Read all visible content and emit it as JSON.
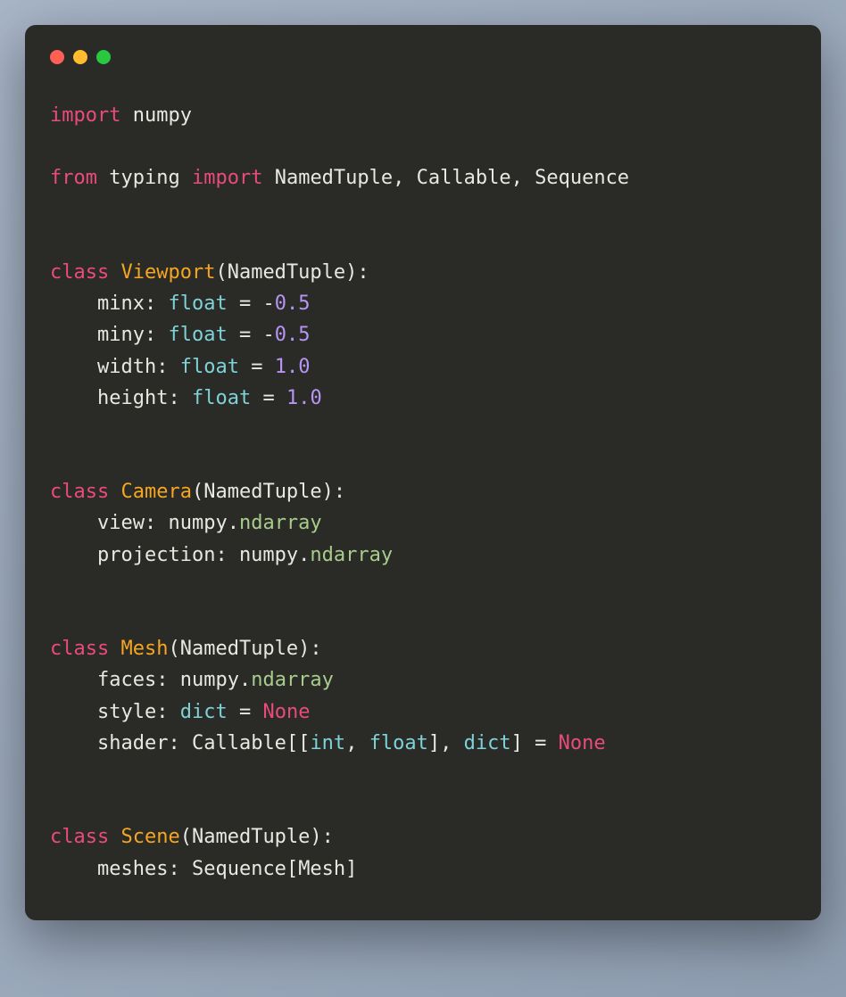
{
  "traffic_lights": {
    "red": "#ff5f57",
    "yellow": "#febc2e",
    "green": "#28c840"
  },
  "code": {
    "line1": {
      "kw_import": "import",
      "mod_numpy": "numpy"
    },
    "line2": {
      "kw_from": "from",
      "mod_typing": "typing",
      "kw_import": "import",
      "names": "NamedTuple, Callable, Sequence"
    },
    "class_viewport": {
      "kw_class": "class",
      "name": "Viewport",
      "base": "NamedTuple",
      "fields": {
        "minx": {
          "name": "minx",
          "type": "float",
          "eq": "=",
          "neg": "-",
          "val": "0.5"
        },
        "miny": {
          "name": "miny",
          "type": "float",
          "eq": "=",
          "neg": "-",
          "val": "0.5"
        },
        "width": {
          "name": "width",
          "type": "float",
          "eq": "=",
          "val": "1.0"
        },
        "height": {
          "name": "height",
          "type": "float",
          "eq": "=",
          "val": "1.0"
        }
      }
    },
    "class_camera": {
      "kw_class": "class",
      "name": "Camera",
      "base": "NamedTuple",
      "fields": {
        "view": {
          "name": "view",
          "mod": "numpy",
          "type": "ndarray"
        },
        "projection": {
          "name": "projection",
          "mod": "numpy",
          "type": "ndarray"
        }
      }
    },
    "class_mesh": {
      "kw_class": "class",
      "name": "Mesh",
      "base": "NamedTuple",
      "fields": {
        "faces": {
          "name": "faces",
          "mod": "numpy",
          "type": "ndarray"
        },
        "style": {
          "name": "style",
          "type": "dict",
          "eq": "=",
          "none": "None"
        },
        "shader": {
          "name": "shader",
          "callable": "Callable",
          "int": "int",
          "float": "float",
          "dict": "dict",
          "eq": "=",
          "none": "None"
        }
      }
    },
    "class_scene": {
      "kw_class": "class",
      "name": "Scene",
      "base": "NamedTuple",
      "fields": {
        "meshes": {
          "name": "meshes",
          "seq": "Sequence",
          "mesh": "Mesh"
        }
      }
    }
  }
}
